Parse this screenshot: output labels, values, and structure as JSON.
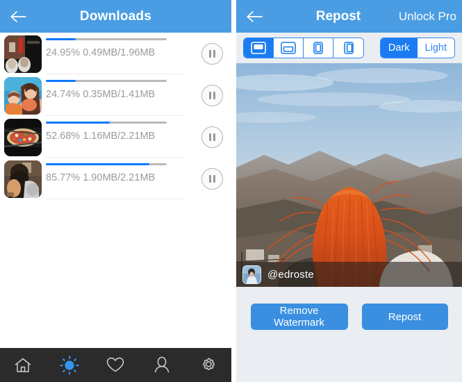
{
  "downloads_screen": {
    "nav": {
      "back_icon": "back-arrow-icon",
      "title": "Downloads"
    },
    "rows": [
      {
        "percent": "24.95%",
        "sizes": "0.49MB/1.96MB",
        "progress": 24.95,
        "pause_icon": "pause-icon"
      },
      {
        "percent": "24.74%",
        "sizes": "0.35MB/1.41MB",
        "progress": 24.74,
        "pause_icon": "pause-icon"
      },
      {
        "percent": "52.68%",
        "sizes": "1.16MB/2.21MB",
        "progress": 52.68,
        "pause_icon": "pause-icon"
      },
      {
        "percent": "85.77%",
        "sizes": "1.90MB/2.21MB",
        "progress": 85.77,
        "pause_icon": "pause-icon"
      }
    ],
    "tabbar": {
      "items": [
        {
          "icon": "home-icon",
          "active": false
        },
        {
          "icon": "sun-burst-icon",
          "active": true
        },
        {
          "icon": "heart-icon",
          "active": false
        },
        {
          "icon": "person-icon",
          "active": false
        },
        {
          "icon": "gear-icon",
          "active": false
        }
      ]
    }
  },
  "repost_screen": {
    "nav": {
      "back_icon": "back-arrow-icon",
      "title": "Repost",
      "unlock_label": "Unlock Pro"
    },
    "position_segments": [
      {
        "icon": "watermark-top-icon",
        "active": true
      },
      {
        "icon": "watermark-bottom-icon",
        "active": false
      },
      {
        "icon": "watermark-left-icon",
        "active": false
      },
      {
        "icon": "watermark-right-icon",
        "active": false
      }
    ],
    "theme_segments": [
      {
        "label": "Dark",
        "active": true
      },
      {
        "label": "Light",
        "active": false
      }
    ],
    "watermark": {
      "username": "@edroste",
      "avatar_icon": "user-avatar-icon"
    },
    "buttons": {
      "remove_watermark": "Remove Watermark",
      "repost": "Repost"
    }
  },
  "colors": {
    "nav_blue": "#4a9de2",
    "accent_blue": "#1a7cf0",
    "progress_blue": "#0a78ff",
    "button_blue": "#3a8fe0",
    "panel_bg": "#eaeef2",
    "tabbar_bg": "#2b2b2b",
    "text_gray": "#9b9b9b"
  }
}
